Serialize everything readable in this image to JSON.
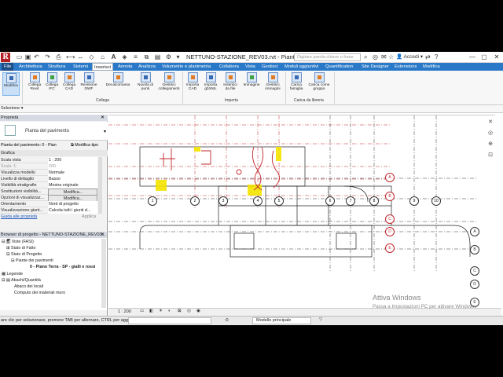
{
  "titlebar": {
    "app_logo": "R",
    "document_title": "NETTUNO-STAZIONE_REV03.rvt - Pianta ...",
    "search_placeholder": "Digitare parola chiave o frase",
    "user_label": "Accedi",
    "help_label": "?"
  },
  "tabs": [
    {
      "label": "File"
    },
    {
      "label": "Architettura"
    },
    {
      "label": "Struttura"
    },
    {
      "label": "Sistemi"
    },
    {
      "label": "Inserisci"
    },
    {
      "label": "Annota"
    },
    {
      "label": "Analizza"
    },
    {
      "label": "Volumetrie e planimetria"
    },
    {
      "label": "Collabora"
    },
    {
      "label": "Vista"
    },
    {
      "label": "Gestisci"
    },
    {
      "label": "Moduli aggiuntivi"
    },
    {
      "label": "Quantification"
    },
    {
      "label": "Site Designer"
    },
    {
      "label": "Extensions"
    },
    {
      "label": "Modifica"
    }
  ],
  "ribbon": {
    "buttons": [
      {
        "label": "Modifica"
      },
      {
        "label": "Collega Revit"
      },
      {
        "label": "Collega IFC"
      },
      {
        "label": "Collega CAD"
      },
      {
        "label": "Revisione DWF"
      },
      {
        "label": "Decalcomania"
      },
      {
        "label": "Nuvola di punti"
      },
      {
        "label": "Gestisci collegamenti"
      },
      {
        "label": "Importa CAD"
      },
      {
        "label": "Importa gbXML"
      },
      {
        "label": "Inserisci da file"
      },
      {
        "label": "Immagine"
      },
      {
        "label": "Gestisci immagini"
      },
      {
        "label": "Carica famiglia"
      },
      {
        "label": "Carica come gruppo"
      }
    ],
    "panels": {
      "selezione": "Selezione",
      "collega": "Collega",
      "importa": "Importa",
      "libreria": "Carica da libreria"
    }
  },
  "properties": {
    "header": "Proprietà",
    "type_name": "Pianta del pavimento",
    "instance_selector": "Pianta del pavimento: 0 - Pian",
    "edit_type": "Modifica tipo",
    "group": "Grafica",
    "rows": [
      {
        "key": "Scala vista",
        "value": "1 : 200"
      },
      {
        "key": "Scala: 1:",
        "value": "200"
      },
      {
        "key": "Visualizza modello",
        "value": "Normale"
      },
      {
        "key": "Livello di dettaglio",
        "value": "Basso"
      },
      {
        "key": "Visibilità stratigrafie",
        "value": "Mostra originale"
      },
      {
        "key": "Sostituzioni visibilità...",
        "value": "Modifica..."
      },
      {
        "key": "Opzioni di visualizzaz...",
        "value": "Modifica..."
      },
      {
        "key": "Orientamento",
        "value": "Nord di progetto"
      },
      {
        "key": "Visualizzazione giunt...",
        "value": "Calcola tutti i giunti d..."
      }
    ],
    "help_link": "Guida alle proprietà",
    "apply": "Applica"
  },
  "browser": {
    "header": "Browser di progetto - NETTUNO-STAZIONE_REV03...",
    "items": [
      {
        "label": "Viste (FASI)"
      },
      {
        "label": "Stato di Fatto"
      },
      {
        "label": "Stato di Progetto"
      },
      {
        "label": "Piante dei pavimenti"
      },
      {
        "label": "0 - Piano Terra - SP - gialli e rossi"
      },
      {
        "label": "Legende"
      },
      {
        "label": "Abachi/Quantità"
      },
      {
        "label": "Abaco dei locali"
      },
      {
        "label": "Computo dei materiali muro"
      }
    ]
  },
  "grid_labels": {
    "letters": [
      "A",
      "B",
      "C",
      "D",
      "E",
      "A",
      "B",
      "C",
      "D",
      "E"
    ],
    "numbers": [
      "1",
      "2",
      "3",
      "4",
      "5",
      "6",
      "7",
      "8",
      "9",
      "10"
    ]
  },
  "viewbar": {
    "scale": "1 : 200"
  },
  "statusbar": {
    "hint": "are clic per selezionare, premere TAB per alternare, CTRL per agg",
    "zero": ":0",
    "model": "Modello principale"
  },
  "watermark": {
    "line1": "Attiva Windows",
    "line2": "Passa a Impostazioni PC per attivare Windows."
  },
  "colors": {
    "tab_bar": "#2a79c8",
    "grid_red": "#c1272d",
    "highlight_yellow": "#f5e400"
  }
}
